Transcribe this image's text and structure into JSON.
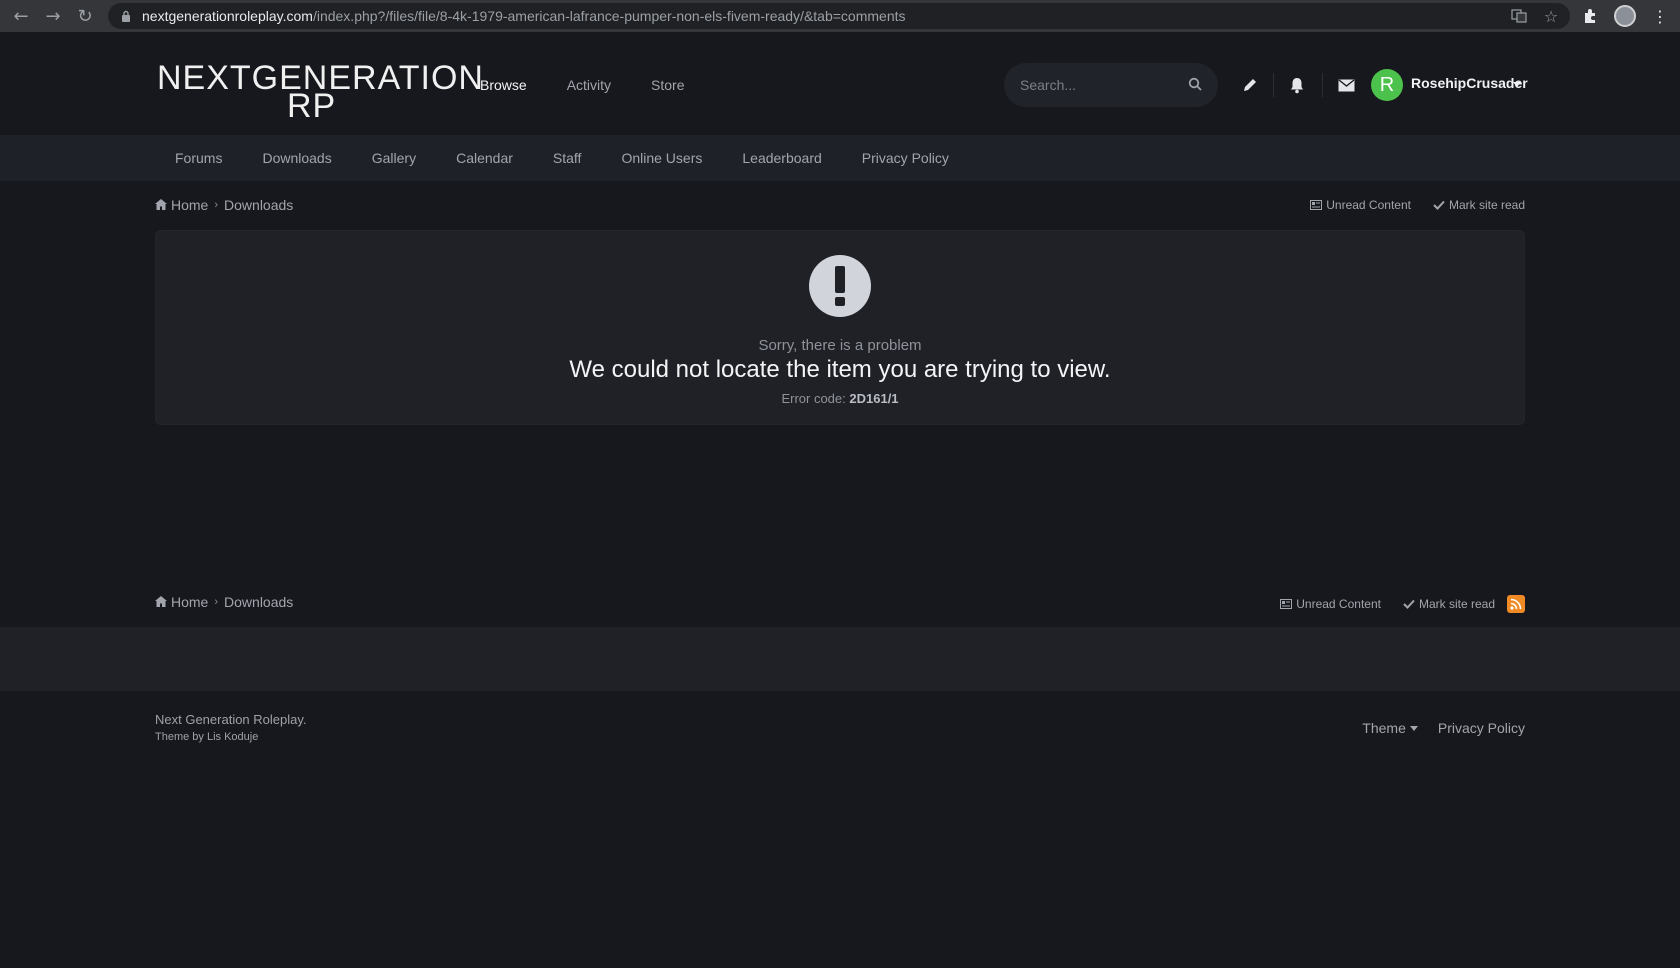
{
  "browser": {
    "url_host": "nextgenerationroleplay.com",
    "url_path": "/index.php?/files/file/8-4k-1979-american-lafrance-pumper-non-els-fivem-ready/&tab=comments"
  },
  "header": {
    "logo_line1": "NEXTGENERATION",
    "logo_line2": "RP",
    "nav": [
      "Browse",
      "Activity",
      "Store"
    ],
    "search_placeholder": "Search...",
    "user": {
      "initial": "R",
      "name": "RosehipCrusader"
    }
  },
  "subnav": [
    "Forums",
    "Downloads",
    "Gallery",
    "Calendar",
    "Staff",
    "Online Users",
    "Leaderboard",
    "Privacy Policy"
  ],
  "breadcrumb": {
    "home": "Home",
    "current": "Downloads"
  },
  "crumb_actions": {
    "unread": "Unread Content",
    "mark_read": "Mark site read"
  },
  "error": {
    "subtitle": "Sorry, there is a problem",
    "title": "We could not locate the item you are trying to view.",
    "code_label": "Error code:",
    "code": "2D161/1"
  },
  "footer": {
    "site": "Next Generation Roleplay.",
    "theme_by": "Theme by Lis Koduje",
    "theme_label": "Theme",
    "privacy": "Privacy Policy"
  },
  "colors": {
    "accent_green": "#4cc24c",
    "rss_orange": "#f08a24"
  }
}
